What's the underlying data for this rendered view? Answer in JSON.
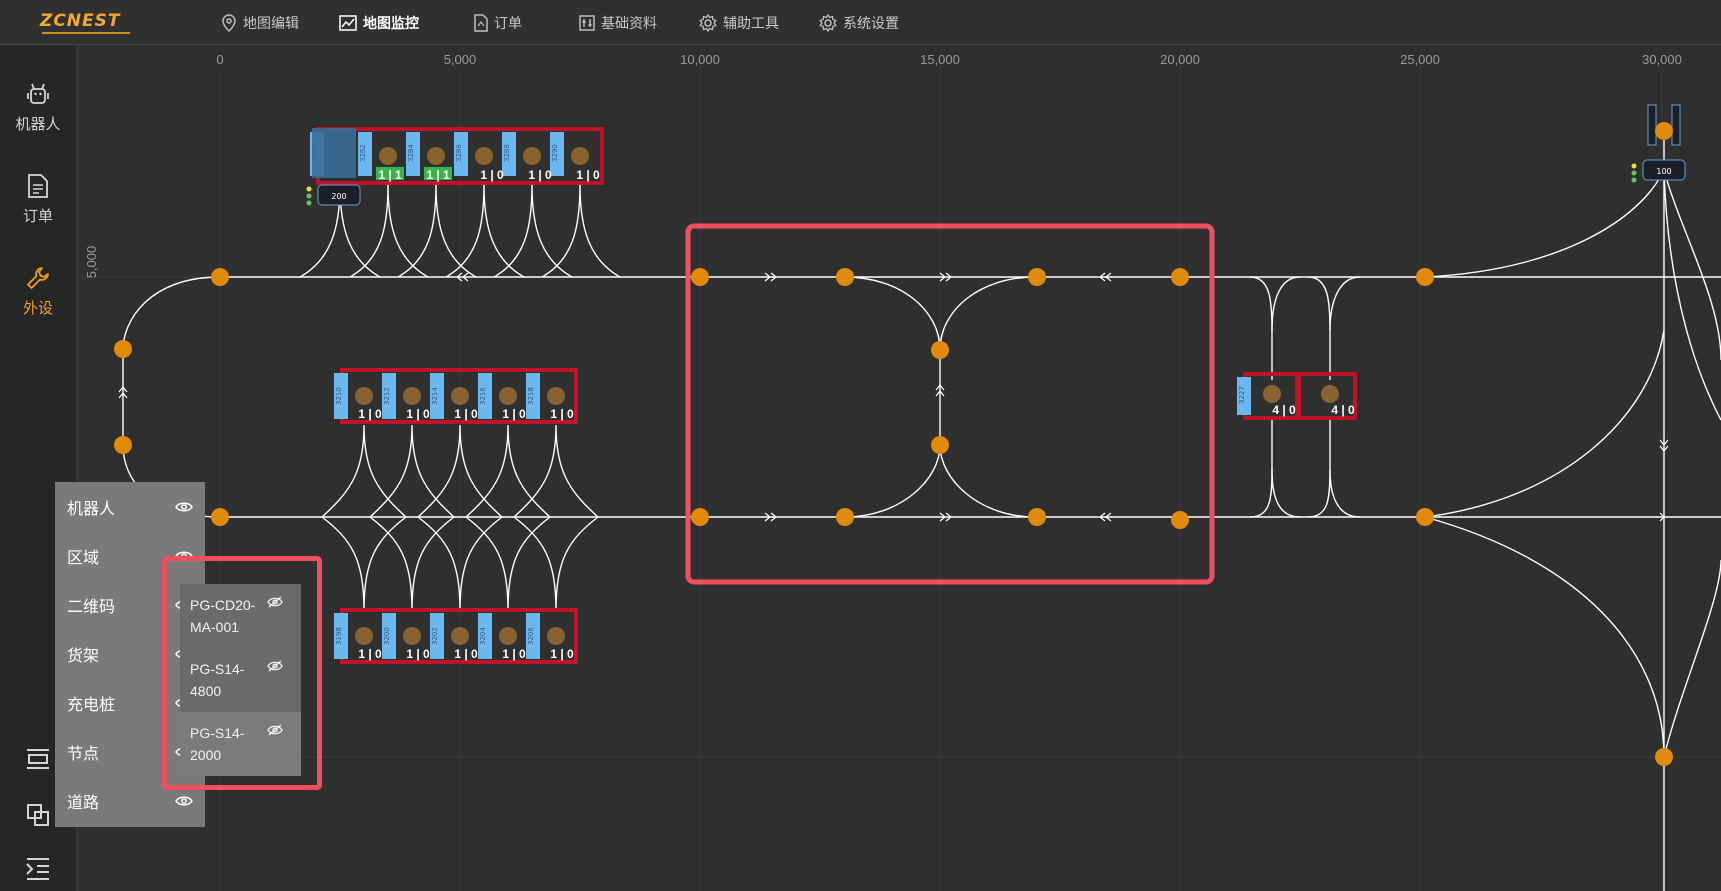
{
  "app": {
    "logo": "ZCNEST",
    "nav": [
      {
        "label": "地图编辑",
        "icon": "map-pin-icon"
      },
      {
        "label": "地图监控",
        "icon": "line-chart-icon"
      },
      {
        "label": "订单",
        "icon": "document-icon"
      },
      {
        "label": "基础资料",
        "icon": "sliders-icon"
      },
      {
        "label": "辅助工具",
        "icon": "gear-icon"
      },
      {
        "label": "系统设置",
        "icon": "gear-icon"
      }
    ]
  },
  "sidebar": {
    "items": [
      {
        "label": "机器人",
        "icon": "robot-icon"
      },
      {
        "label": "订单",
        "icon": "document-icon"
      },
      {
        "label": "外设",
        "icon": "wrench-icon"
      }
    ]
  },
  "ruler": {
    "x_ticks": [
      "0",
      "5,000",
      "10,000",
      "15,000",
      "20,000",
      "25,000",
      "30,000"
    ],
    "y_ticks": [
      "5,000"
    ]
  },
  "layers": {
    "items": [
      {
        "label": "机器人"
      },
      {
        "label": "区域"
      },
      {
        "label": "二维码"
      },
      {
        "label": "货架"
      },
      {
        "label": "充电桩"
      },
      {
        "label": "节点"
      },
      {
        "label": "道路"
      }
    ],
    "shelf_types": [
      {
        "label": "PG-CD20-MA-001"
      },
      {
        "label": "PG-S14-4800"
      },
      {
        "label": "PG-S14-2000"
      }
    ]
  },
  "robots": [
    {
      "id": "200"
    },
    {
      "id": "100"
    }
  ],
  "shelves": {
    "top_row": {
      "ids": [
        "3278",
        "3282",
        "3284",
        "3286",
        "3288",
        "3290"
      ],
      "counts": [
        "1 | 1",
        "1 | 1",
        "1 | 0",
        "1 | 0",
        "1 | 0"
      ]
    },
    "mid_row": {
      "ids": [
        "3210",
        "3212",
        "3214",
        "3216",
        "3218"
      ],
      "counts": [
        "1 | 0",
        "1 | 0",
        "1 | 0",
        "1 | 0",
        "1 | 0"
      ]
    },
    "bottom_row": {
      "ids": [
        "3198",
        "3200",
        "3202",
        "3204",
        "3206"
      ],
      "counts": [
        "1 | 0",
        "1 | 0",
        "1 | 0",
        "1 | 0",
        "1 | 0"
      ]
    },
    "right_group": {
      "ids": [
        "3227"
      ],
      "counts": [
        "4 | 0",
        "4 | 0"
      ]
    }
  },
  "colors": {
    "accent": "#f0a020",
    "node": "#e18a0c",
    "shelf_border": "#c11327",
    "shelf_tile": "#6bb8f0",
    "highlight": "#f0505e",
    "road": "#ffffff"
  }
}
